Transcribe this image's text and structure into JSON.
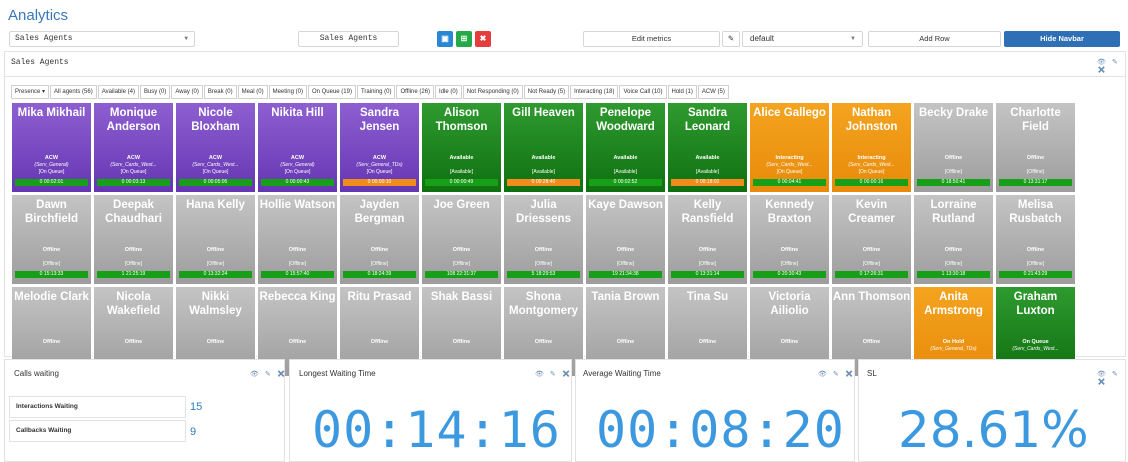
{
  "app": {
    "title": "Analytics"
  },
  "toolbar": {
    "dashboard_select": "Sales Agents",
    "title_input": "Sales Agents",
    "edit_metrics": "Edit metrics",
    "metrics_select": "default",
    "add_row": "Add Row",
    "hide_navbar": "Hide Navbar",
    "colors": {
      "save": "#2a87d6",
      "export": "#25a949",
      "close": "#e53d3d",
      "primary": "#2f6fb5"
    }
  },
  "panel": {
    "title": "Sales Agents"
  },
  "tabs": [
    "Presence ▾",
    "All agents (56)",
    "Available (4)",
    "Busy (0)",
    "Away (0)",
    "Break (0)",
    "Meal (0)",
    "Meeting (0)",
    "On Queue (19)",
    "Training (0)",
    "Offline (26)",
    "Idle (0)",
    "Not Responding (0)",
    "Not Ready (5)",
    "Interacting (18)",
    "Voice Call (10)",
    "Hold (1)",
    "ACW (5)"
  ],
  "agents": [
    {
      "name": "Mika Mikhail",
      "color": "purple",
      "status": "ACW",
      "queue": "(Serv_General)",
      "code": "[On Queue]",
      "time": "0 00:02:01",
      "warn": false
    },
    {
      "name": "Monique Anderson",
      "color": "purple",
      "status": "ACW",
      "queue": "(Serv_Cards_West...",
      "code": "[On Queue]",
      "time": "0 00:03:13",
      "warn": false
    },
    {
      "name": "Nicole Bloxham",
      "color": "purple",
      "status": "ACW",
      "queue": "(Serv_Cards_West...",
      "code": "[On Queue]",
      "time": "0 00:05:05",
      "warn": false
    },
    {
      "name": "Nikita Hill",
      "color": "purple",
      "status": "ACW",
      "queue": "(Serv_General)",
      "code": "[On Queue]",
      "time": "0 00:00:43",
      "warn": false
    },
    {
      "name": "Sandra Jensen",
      "color": "purple",
      "status": "ACW",
      "queue": "(Serv_General_TDs)",
      "code": "[On Queue]",
      "time": "0 00:00:10",
      "warn": true
    },
    {
      "name": "Alison Thomson",
      "color": "green",
      "status": "Available",
      "queue": "",
      "code": "[Available]",
      "time": "0 00:00:49",
      "warn": false
    },
    {
      "name": "Gill Heaven",
      "color": "green",
      "status": "Available",
      "queue": "",
      "code": "[Available]",
      "time": "0 00:28:40",
      "warn": true
    },
    {
      "name": "Penelope Woodward",
      "color": "green",
      "status": "Available",
      "queue": "",
      "code": "[Available]",
      "time": "0 00:02:52",
      "warn": false
    },
    {
      "name": "Sandra Leonard",
      "color": "green",
      "status": "Available",
      "queue": "",
      "code": "[Available]",
      "time": "0 00:18:02",
      "warn": true
    },
    {
      "name": "Alice Gallego",
      "color": "orange",
      "status": "Interacting",
      "queue": "(Serv_Cards_West...",
      "code": "[On Queue]",
      "time": "0 00:04:41",
      "warn": false
    },
    {
      "name": "Nathan Johnston",
      "color": "orange",
      "status": "Interacting",
      "queue": "(Serv_Cards_West...",
      "code": "[On Queue]",
      "time": "0 00:00:16",
      "warn": false
    },
    {
      "name": "Becky Drake",
      "color": "gray",
      "status": "Offline",
      "queue": "",
      "code": "[Offline]",
      "time": "0 18:50:41",
      "warn": false
    },
    {
      "name": "Charlotte Field",
      "color": "gray",
      "status": "Offline",
      "queue": "",
      "code": "[Offline]",
      "time": "0 13:31:17",
      "warn": false
    },
    {
      "name": "Dawn Birchfield",
      "color": "gray",
      "status": "Offline",
      "queue": "",
      "code": "[Offline]",
      "time": "0 15:13:33",
      "warn": false
    },
    {
      "name": "Deepak Chaudhari",
      "color": "gray",
      "status": "Offline",
      "queue": "",
      "code": "[Offline]",
      "time": "1 21:25:19",
      "warn": false
    },
    {
      "name": "Hana Kelly",
      "color": "gray",
      "status": "Offline",
      "queue": "",
      "code": "[Offline]",
      "time": "0 13:32:24",
      "warn": false
    },
    {
      "name": "Hollie Watson",
      "color": "gray",
      "status": "Offline",
      "queue": "",
      "code": "[Offline]",
      "time": "0 15:57:40",
      "warn": false
    },
    {
      "name": "Jayden Bergman",
      "color": "gray",
      "status": "Offline",
      "queue": "",
      "code": "[Offline]",
      "time": "0 18:24:39",
      "warn": false
    },
    {
      "name": "Joe Green",
      "color": "gray",
      "status": "Offline",
      "queue": "",
      "code": "[Offline]",
      "time": "108 22:31:37",
      "warn": false
    },
    {
      "name": "Julia Driessens",
      "color": "gray",
      "status": "Offline",
      "queue": "",
      "code": "[Offline]",
      "time": "5 18:29:53",
      "warn": false
    },
    {
      "name": "Kaye Dawson",
      "color": "gray",
      "status": "Offline",
      "queue": "",
      "code": "[Offline]",
      "time": "19 21:34:38",
      "warn": false
    },
    {
      "name": "Kelly Ransfield",
      "color": "gray",
      "status": "Offline",
      "queue": "",
      "code": "[Offline]",
      "time": "0 13:31:14",
      "warn": false
    },
    {
      "name": "Kennedy Braxton",
      "color": "gray",
      "status": "Offline",
      "queue": "",
      "code": "[Offline]",
      "time": "0 20:30:43",
      "warn": false
    },
    {
      "name": "Kevin Creamer",
      "color": "gray",
      "status": "Offline",
      "queue": "",
      "code": "[Offline]",
      "time": "0 17:26:31",
      "warn": false
    },
    {
      "name": "Lorraine Rutland",
      "color": "gray",
      "status": "Offline",
      "queue": "",
      "code": "[Offline]",
      "time": "1 13:30:18",
      "warn": false
    },
    {
      "name": "Melisa Rusbatch",
      "color": "gray",
      "status": "Offline",
      "queue": "",
      "code": "[Offline]",
      "time": "0 21:43:29",
      "warn": false
    },
    {
      "name": "Melodie Clark",
      "color": "gray",
      "status": "Offline",
      "queue": "",
      "code": "",
      "time": "",
      "warn": false
    },
    {
      "name": "Nicola Wakefield",
      "color": "gray",
      "status": "Offline",
      "queue": "",
      "code": "",
      "time": "",
      "warn": false
    },
    {
      "name": "Nikki Walmsley",
      "color": "gray",
      "status": "Offline",
      "queue": "",
      "code": "",
      "time": "",
      "warn": false
    },
    {
      "name": "Rebecca King",
      "color": "gray",
      "status": "Offline",
      "queue": "",
      "code": "",
      "time": "",
      "warn": false
    },
    {
      "name": "Ritu Prasad",
      "color": "gray",
      "status": "Offline",
      "queue": "",
      "code": "",
      "time": "",
      "warn": false
    },
    {
      "name": "Shak Bassi",
      "color": "gray",
      "status": "Offline",
      "queue": "",
      "code": "",
      "time": "",
      "warn": false
    },
    {
      "name": "Shona Montgomery",
      "color": "gray",
      "status": "Offline",
      "queue": "",
      "code": "",
      "time": "",
      "warn": false
    },
    {
      "name": "Tania Brown",
      "color": "gray",
      "status": "Offline",
      "queue": "",
      "code": "",
      "time": "",
      "warn": false
    },
    {
      "name": "Tina Su",
      "color": "gray",
      "status": "Offline",
      "queue": "",
      "code": "",
      "time": "",
      "warn": false
    },
    {
      "name": "Victoria Ailiolio",
      "color": "gray",
      "status": "Offline",
      "queue": "",
      "code": "",
      "time": "",
      "warn": false
    },
    {
      "name": "Ann Thomson",
      "color": "gray",
      "status": "Offline",
      "queue": "",
      "code": "",
      "time": "",
      "warn": false
    },
    {
      "name": "Anita Armstrong",
      "color": "orange",
      "status": "On Hold",
      "queue": "(Serv_General_TDs)",
      "code": "",
      "time": "",
      "warn": false
    },
    {
      "name": "Graham Luxton",
      "color": "green",
      "status": "On Queue",
      "queue": "(Serv_Cards_West...",
      "code": "",
      "time": "",
      "warn": false
    }
  ],
  "calls_waiting": {
    "title": "Calls waiting",
    "rows": [
      {
        "label": "Interactions Waiting",
        "value": "15"
      },
      {
        "label": "Callbacks Waiting",
        "value": "9"
      }
    ]
  },
  "longest_wait": {
    "title": "Longest Waiting Time",
    "value": "00:14:16"
  },
  "average_wait": {
    "title": "Average Waiting Time",
    "value": "00:08:20"
  },
  "sl": {
    "title": "SL",
    "value": "28.61%"
  },
  "widget_icons": "👁 ✎ ✖"
}
